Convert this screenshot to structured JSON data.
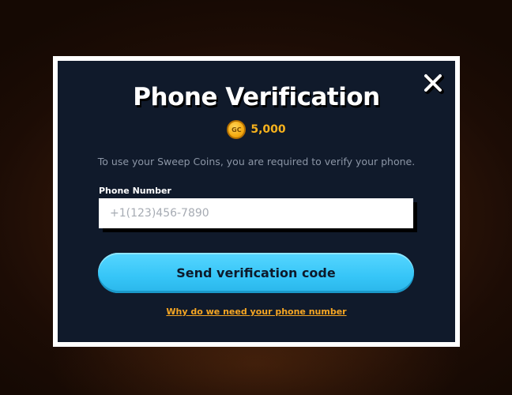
{
  "modal": {
    "title": "Phone Verification",
    "balance": {
      "coin_icon": "gc-coin-icon",
      "coin_label": "GC",
      "amount": "5,000"
    },
    "description": "To use your Sweep Coins, you are required to verify your phone.",
    "phone_field": {
      "label": "Phone Number",
      "value": "",
      "placeholder": "+1(123)456-7890"
    },
    "send_button_label": "Send verification code",
    "why_link_label": "Why do we need your phone number",
    "close_icon": "close-icon"
  },
  "colors": {
    "modal_background": "#101a2b",
    "frame": "#ffffff",
    "accent_button": "#36c5f7",
    "link": "#f6a623",
    "coin": "#f7b21d"
  }
}
